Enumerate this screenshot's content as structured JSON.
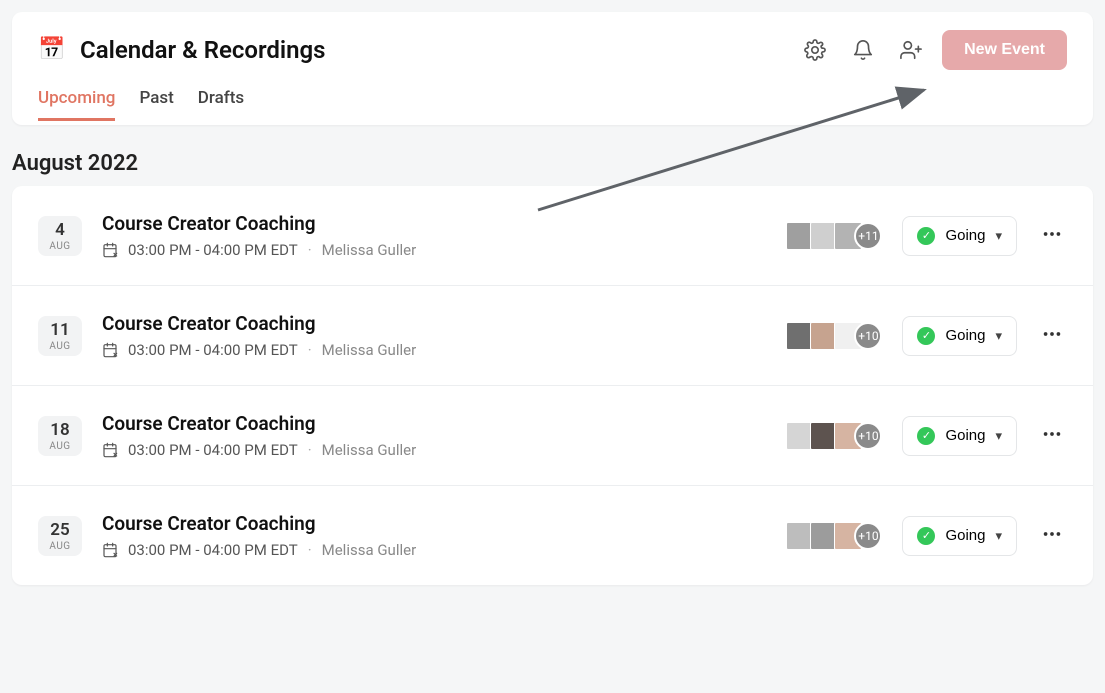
{
  "header": {
    "icon": "📅",
    "title": "Calendar & Recordings",
    "new_event_label": "New Event"
  },
  "tabs": [
    {
      "label": "Upcoming",
      "active": true
    },
    {
      "label": "Past",
      "active": false
    },
    {
      "label": "Drafts",
      "active": false
    }
  ],
  "month_label": "August 2022",
  "events": [
    {
      "day": "4",
      "mon": "AUG",
      "title": "Course Creator Coaching",
      "time": "03:00 PM - 04:00 PM EDT",
      "host": "Melissa Guller",
      "attendees": [
        "#9f9f9f",
        "#cfcfcf",
        "#b3b3b3"
      ],
      "more": "+11",
      "status": "Going"
    },
    {
      "day": "11",
      "mon": "AUG",
      "title": "Course Creator Coaching",
      "time": "03:00 PM - 04:00 PM EDT",
      "host": "Melissa Guller",
      "attendees": [
        "#6f6f6f",
        "#c6a38f",
        "#f0f0f0"
      ],
      "more": "+10",
      "status": "Going"
    },
    {
      "day": "18",
      "mon": "AUG",
      "title": "Course Creator Coaching",
      "time": "03:00 PM - 04:00 PM EDT",
      "host": "Melissa Guller",
      "attendees": [
        "#d5d5d5",
        "#5d534f",
        "#d6b4a2"
      ],
      "more": "+10",
      "status": "Going"
    },
    {
      "day": "25",
      "mon": "AUG",
      "title": "Course Creator Coaching",
      "time": "03:00 PM - 04:00 PM EDT",
      "host": "Melissa Guller",
      "attendees": [
        "#bdbdbd",
        "#9c9c9c",
        "#d6b4a2"
      ],
      "more": "+10",
      "status": "Going"
    }
  ]
}
